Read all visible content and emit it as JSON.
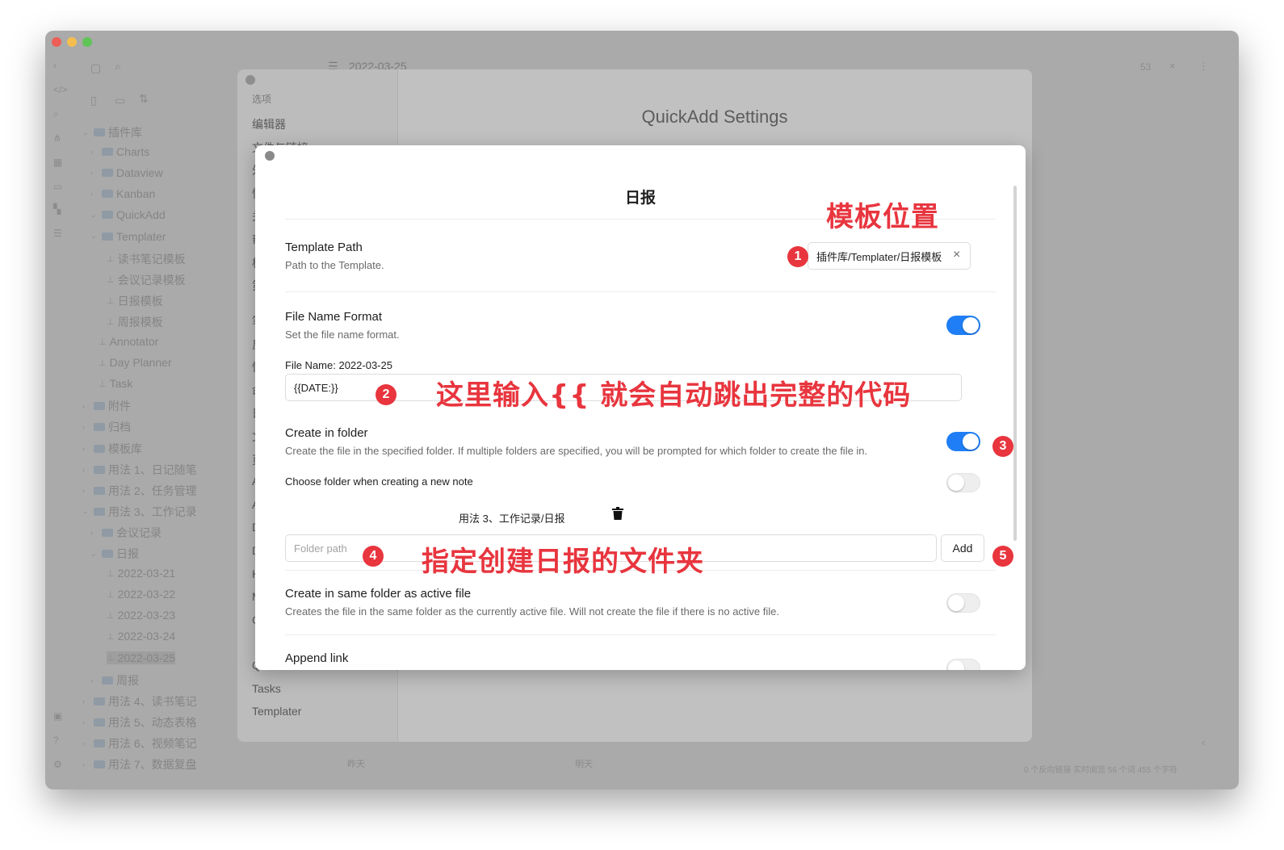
{
  "background_window": {
    "header_title": "2022-03-25",
    "tree": [
      {
        "label": "插件库",
        "kind": "folder",
        "chev": "⌄"
      },
      {
        "label": "Charts",
        "kind": "folder",
        "chev": "›"
      },
      {
        "label": "Dataview",
        "kind": "folder",
        "chev": "›"
      },
      {
        "label": "Kanban",
        "kind": "folder",
        "chev": "›"
      },
      {
        "label": "QuickAdd",
        "kind": "folder",
        "chev": "⌄"
      },
      {
        "label": "Templater",
        "kind": "folder",
        "chev": "⌄"
      },
      {
        "label": "读书笔记模板",
        "kind": "file"
      },
      {
        "label": "会议记录模板",
        "kind": "file"
      },
      {
        "label": "日报模板",
        "kind": "file"
      },
      {
        "label": "周报模板",
        "kind": "file"
      },
      {
        "label": "Annotator",
        "kind": "file"
      },
      {
        "label": "Day Planner",
        "kind": "file"
      },
      {
        "label": "Task",
        "kind": "file"
      },
      {
        "label": "附件",
        "kind": "folder",
        "chev": "›"
      },
      {
        "label": "归档",
        "kind": "folder",
        "chev": "›"
      },
      {
        "label": "模板库",
        "kind": "folder",
        "chev": "›"
      },
      {
        "label": "用法 1、日记随笔",
        "kind": "folder",
        "chev": "›"
      },
      {
        "label": "用法 2、任务管理",
        "kind": "folder",
        "chev": "›"
      },
      {
        "label": "用法 3、工作记录",
        "kind": "folder",
        "chev": "⌄"
      },
      {
        "label": "会议记录",
        "kind": "folder",
        "chev": "›"
      },
      {
        "label": "日报",
        "kind": "folder",
        "chev": "⌄"
      },
      {
        "label": "2022-03-21",
        "kind": "file"
      },
      {
        "label": "2022-03-22",
        "kind": "file"
      },
      {
        "label": "2022-03-23",
        "kind": "file"
      },
      {
        "label": "2022-03-24",
        "kind": "file"
      },
      {
        "label": "2022-03-25",
        "kind": "file",
        "active": true
      },
      {
        "label": "周报",
        "kind": "folder",
        "chev": "›"
      },
      {
        "label": "用法 4、读书笔记",
        "kind": "folder",
        "chev": "›"
      },
      {
        "label": "用法 5、动态表格",
        "kind": "folder",
        "chev": "›"
      },
      {
        "label": "用法 6、视频笔记",
        "kind": "folder",
        "chev": "›"
      },
      {
        "label": "用法 7、数据复盘",
        "kind": "folder",
        "chev": "›"
      }
    ],
    "footer_left": "昨天",
    "footer_mid": "明天",
    "status": "0 个反向链接   实时阅览   56 个词   455 个字符",
    "header_right_count": "53"
  },
  "settings_dialog": {
    "title": "QuickAdd Settings",
    "nav_heading": "选项",
    "nav_items": [
      "编辑器",
      "文件与链接",
      "外",
      "快",
      "关",
      "帮",
      "核",
      "第"
    ],
    "nav_items_lower": [
      "笔",
      "反",
      "快",
      "命",
      "日",
      "文",
      "页",
      "A",
      "A",
      "D",
      "D",
      "K",
      "M",
      "C"
    ],
    "nav_bottom": [
      "QuickAdd",
      "Tasks",
      "Templater"
    ]
  },
  "modal": {
    "title": "日报",
    "template_path": {
      "name": "Template Path",
      "desc": "Path to the Template.",
      "value": "插件库/Templater/日报模板",
      "clear": "×"
    },
    "file_name_format": {
      "name": "File Name Format",
      "desc": "Set the file name format.",
      "enabled": true,
      "preview": "File Name: 2022-03-25",
      "value": "{{DATE:}}"
    },
    "create_in_folder": {
      "name": "Create in folder",
      "desc": "Create the file in the specified folder. If multiple folders are specified, you will be prompted for which folder to create the file in.",
      "enabled": true
    },
    "choose_folder": {
      "name": "Choose folder when creating a new note",
      "enabled": false
    },
    "folder_entry": "用法 3、工作记录/日报",
    "folder_input": {
      "placeholder": "Folder path",
      "add_label": "Add"
    },
    "same_folder": {
      "name": "Create in same folder as active file",
      "desc": "Creates the file in the same folder as the currently active file. Will not create the file if there is no active file.",
      "enabled": false
    },
    "append_link": {
      "name": "Append link"
    }
  },
  "annotations": {
    "template_location": "模板位置",
    "type_hint": "这里输入{{ 就会自动跳出完整的代码",
    "folder_hint": "指定创建日报的文件夹",
    "badges": [
      "1",
      "2",
      "3",
      "4",
      "5"
    ],
    "color": "#e8353e"
  },
  "colors": {
    "toggle_on": "#1f7ef5",
    "overlay_gray": "#aaaaaa"
  }
}
